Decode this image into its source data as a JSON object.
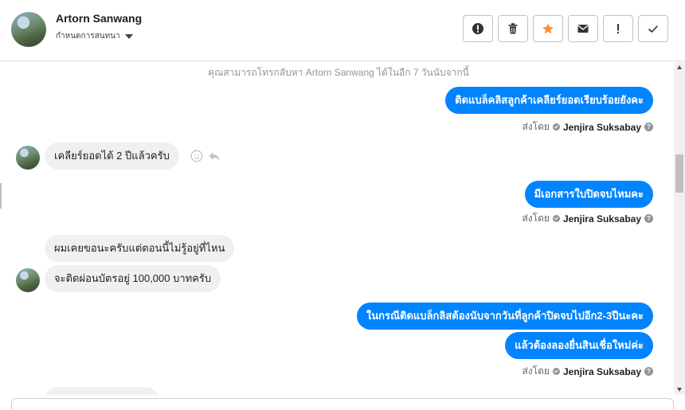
{
  "header": {
    "contact_name": "Artorn Sanwang",
    "assign_label": "กำหนดการสนทนา"
  },
  "toolbar": [
    {
      "name": "alert-icon",
      "label": "Report"
    },
    {
      "name": "trash-icon",
      "label": "Delete"
    },
    {
      "name": "star-icon",
      "label": "Star"
    },
    {
      "name": "envelope-icon",
      "label": "Mark unread"
    },
    {
      "name": "exclamation-icon",
      "label": "Follow up"
    },
    {
      "name": "check-icon",
      "label": "Done"
    }
  ],
  "colors": {
    "accent": "#0084ff",
    "star": "#f7923a",
    "incoming": "#f1f0f0"
  },
  "notice": "คุณสามารถโทรกลับหา Artorn Sanwang ได้ในอีก 7 วันนับจากนี้",
  "messages": {
    "m1": "ติดแบล็คลิสลูกค้าเคลียร์ยอดเรียบร้อยยังคะ",
    "m2": "เคลียร์ยอดได้ 2 ปีแล้วครับ",
    "m3": "มีเอกสารใบปิดจบไหมคะ",
    "m4": "ผมเคยขอนะครับแต่ตอนนี้ไม่รู้อยู่ที่ไหน",
    "m5": "จะติดผ่อนบัตรอยู่ 100,000 บาทครับ",
    "m6": "ในกรณีติดแบล็กลิสต้องนับจากวันที่ลูกค้าปิดจบไปอีก2-3ปีนะคะ",
    "m7": "แล้วต้องลองยื่นสินเชื่อใหม่ค่ะ"
  },
  "sent_by": {
    "prefix": "ส่งโดย",
    "agent": "Jenjira Suksabay",
    "help": "?"
  }
}
